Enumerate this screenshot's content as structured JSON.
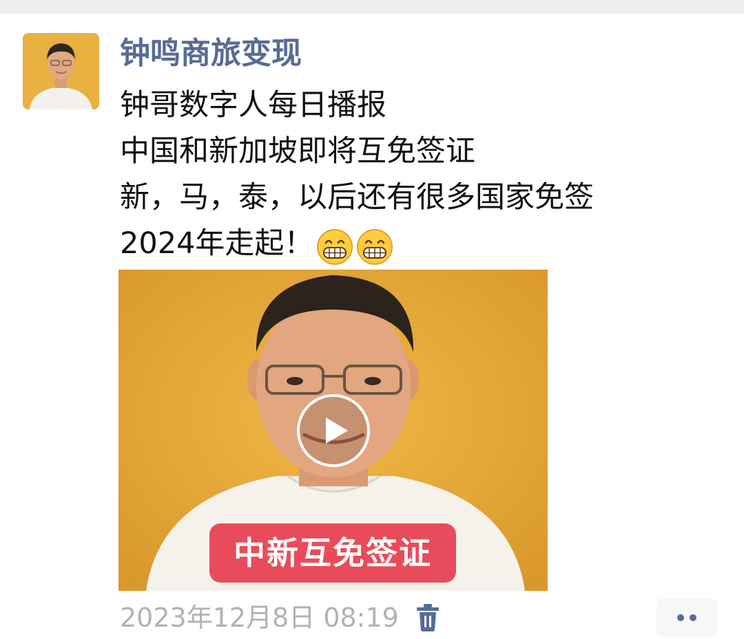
{
  "colors": {
    "author_name": "#576b95",
    "body_text": "#111111",
    "timestamp": "#b2b2b2",
    "caption_badge": "#e84c5a",
    "video_background": "#e7a93a",
    "more_dots": "#576b95"
  },
  "post": {
    "author": "钟鸣商旅变现",
    "lines": [
      "钟哥数字人每日播报",
      "中国和新加坡即将互免签证",
      "新，马，泰，以后还有很多国家免签",
      "2024年走起！"
    ],
    "emojis": [
      "grinning-face-icon",
      "grinning-face-icon"
    ],
    "video": {
      "caption": "中新互免签证",
      "play_icon": "play-icon"
    },
    "timestamp": "2023年12月8日 08:19",
    "delete_icon": "trash-icon",
    "more_icon": "more-dots-icon"
  }
}
